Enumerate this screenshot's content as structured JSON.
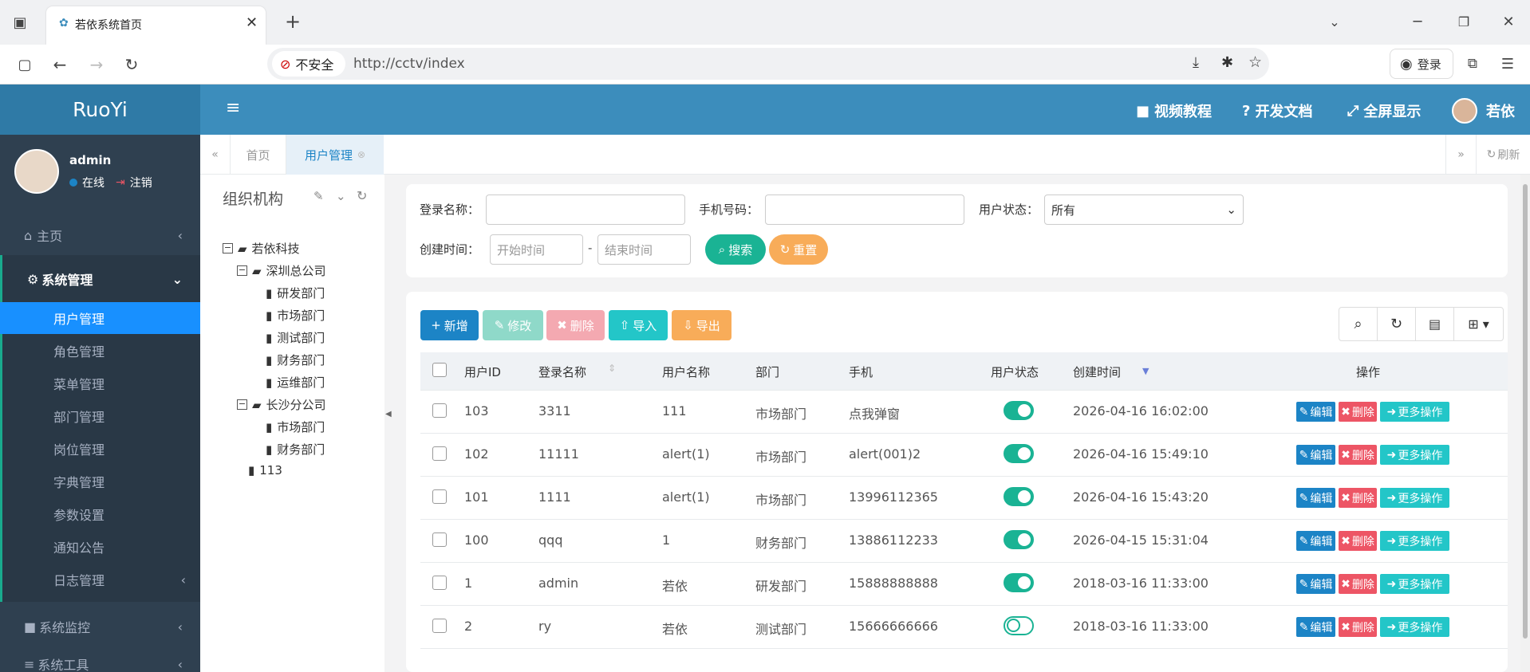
{
  "browser": {
    "tab_title": "若依系统首页",
    "security_label": "不安全",
    "url": "http://cctv/index",
    "login_label": "登录"
  },
  "header": {
    "logo": "RuoYi",
    "nav": [
      "视频教程",
      "开发文档",
      "全屏显示"
    ],
    "user_name": "若依"
  },
  "sidebar": {
    "user": "admin",
    "status": "在线",
    "logout": "注销",
    "items": [
      {
        "label": "主页"
      },
      {
        "label": "系统管理"
      },
      {
        "label": "系统监控"
      },
      {
        "label": "系统工具"
      }
    ],
    "sub_items": [
      "用户管理",
      "角色管理",
      "菜单管理",
      "部门管理",
      "岗位管理",
      "字典管理",
      "参数设置",
      "通知公告",
      "日志管理"
    ]
  },
  "content_tabs": {
    "home": "首页",
    "active": "用户管理",
    "refresh": "刷新"
  },
  "tree": {
    "title": "组织机构",
    "nodes": [
      "若依科技",
      "深圳总公司",
      "研发部门",
      "市场部门",
      "测试部门",
      "财务部门",
      "运维部门",
      "长沙分公司",
      "市场部门",
      "财务部门",
      "113"
    ]
  },
  "search": {
    "login_name_label": "登录名称：",
    "phone_label": "手机号码：",
    "status_label": "用户状态：",
    "status_value": "所有",
    "created_label": "创建时间：",
    "start_placeholder": "开始时间",
    "end_placeholder": "结束时间",
    "dash": "-",
    "search_btn": "搜索",
    "reset_btn": "重置"
  },
  "toolbar": {
    "add": "新增",
    "edit": "修改",
    "delete": "删除",
    "import": "导入",
    "export": "导出"
  },
  "table": {
    "columns": [
      "用户ID",
      "登录名称",
      "用户名称",
      "部门",
      "手机",
      "用户状态",
      "创建时间",
      "操作"
    ],
    "rows": [
      {
        "id": "103",
        "login": "3311",
        "name": "111",
        "dept": "市场部门",
        "phone": "点我弹窗",
        "enabled": true,
        "created": "2026-04-16 16:02:00"
      },
      {
        "id": "102",
        "login": "11111",
        "name": "alert(1)",
        "dept": "市场部门",
        "phone": "alert(001)2",
        "enabled": true,
        "created": "2026-04-16 15:49:10"
      },
      {
        "id": "101",
        "login": "1111",
        "name": "alert(1)",
        "dept": "市场部门",
        "phone": "13996112365",
        "enabled": true,
        "created": "2026-04-16 15:43:20"
      },
      {
        "id": "100",
        "login": "qqq",
        "name": "1",
        "dept": "财务部门",
        "phone": "13886112233",
        "enabled": true,
        "created": "2026-04-15 15:31:04"
      },
      {
        "id": "1",
        "login": "admin",
        "name": "若依",
        "dept": "研发部门",
        "phone": "15888888888",
        "enabled": true,
        "created": "2018-03-16 11:33:00"
      },
      {
        "id": "2",
        "login": "ry",
        "name": "若依",
        "dept": "测试部门",
        "phone": "15666666666",
        "enabled": false,
        "created": "2018-03-16 11:33:00"
      }
    ],
    "actions": {
      "edit": "编辑",
      "delete": "删除",
      "more": "更多操作"
    }
  },
  "colors": {
    "header_blue": "#3c8dbc",
    "sidebar_bg": "#2f4050",
    "active_blue": "#1890ff",
    "primary": "#1c84c6",
    "success": "#1ab394",
    "warning": "#f8ac59",
    "danger": "#ed5565",
    "info": "#23c6c8"
  }
}
